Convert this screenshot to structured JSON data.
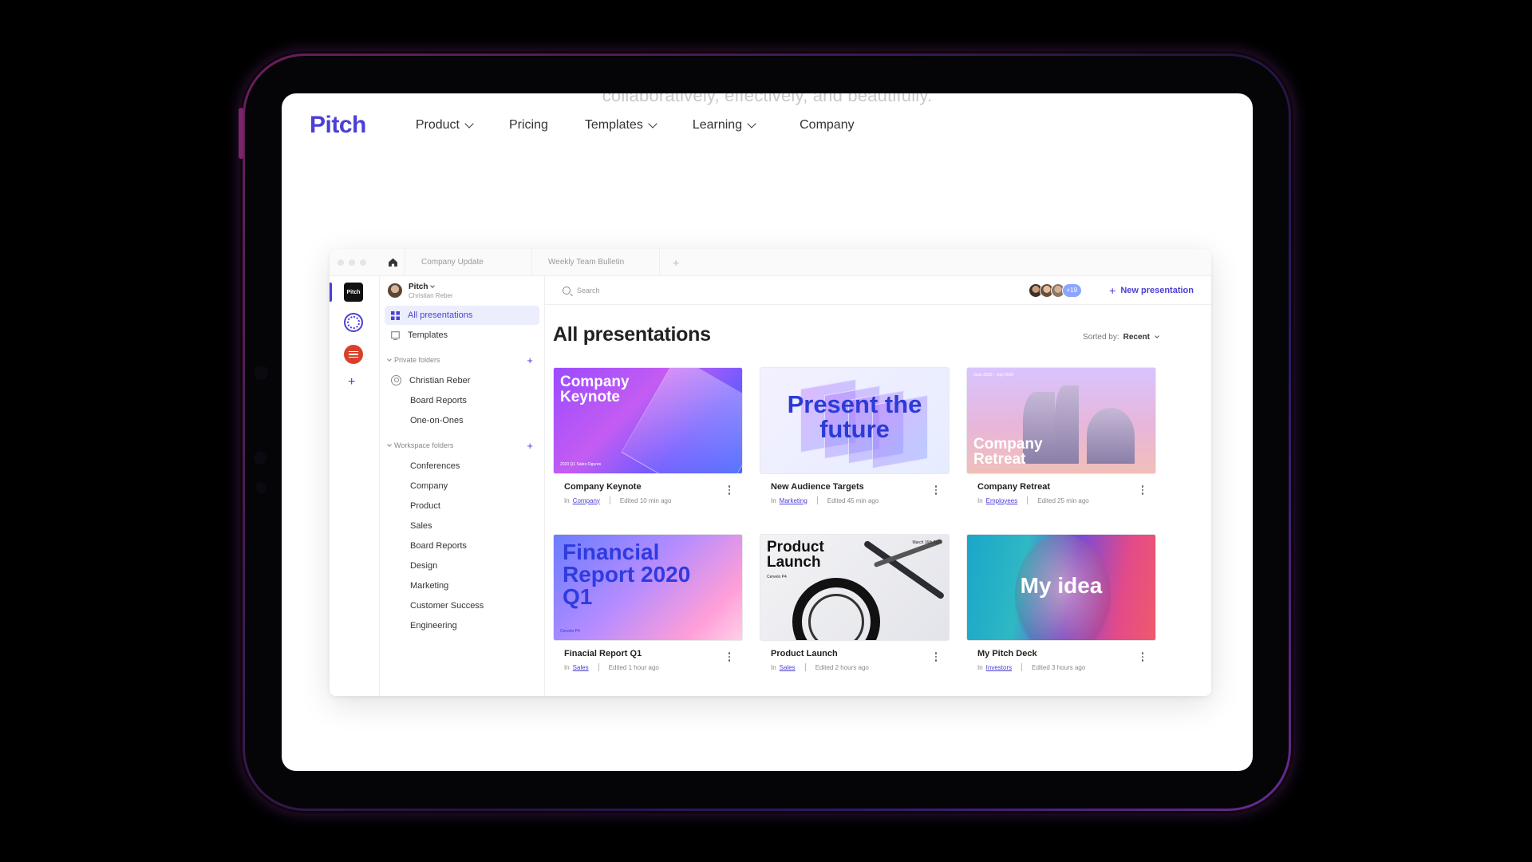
{
  "website": {
    "ghost_text": "collaboratively, effectively, and beautifully.",
    "logo": "Pitch",
    "nav": [
      {
        "label": "Product",
        "has_dropdown": true
      },
      {
        "label": "Pricing",
        "has_dropdown": false
      },
      {
        "label": "Templates",
        "has_dropdown": true
      },
      {
        "label": "Learning",
        "has_dropdown": true
      },
      {
        "label": "Company",
        "has_dropdown": false
      }
    ]
  },
  "app": {
    "tabs": [
      "Company Update",
      "Weekly Team Bulletin"
    ],
    "rail_logo": "Pitch",
    "user": {
      "workspace": "Pitch",
      "name": "Christian Reber"
    },
    "sidebar": {
      "all_presentations": "All presentations",
      "templates": "Templates",
      "private_folders_label": "Private folders",
      "private_folders": [
        "Christian Reber",
        "Board Reports",
        "One-on-Ones"
      ],
      "workspace_folders_label": "Workspace folders",
      "workspace_folders": [
        "Conferences",
        "Company",
        "Product",
        "Sales",
        "Board Reports",
        "Design",
        "Marketing",
        "Customer Success",
        "Engineering"
      ]
    },
    "search_placeholder": "Search",
    "collaborator_count": "+19",
    "new_presentation": "New presentation",
    "page_title": "All presentations",
    "sort_label": "Sorted by:",
    "sort_value": "Recent",
    "in_prefix": "In",
    "cards": [
      {
        "thumb_title": "Company Keynote",
        "thumb_caption": "2020 Q1 Sales Figures",
        "name": "Company Keynote",
        "folder": "Company",
        "edited": "Edited 10 min ago"
      },
      {
        "thumb_title": "Present the future",
        "thumb_caption": "",
        "name": "New Audience Targets",
        "folder": "Marketing",
        "edited": "Edited 45 min ago"
      },
      {
        "thumb_title": "Company Retreat",
        "thumb_caption": "June 2020 – July 2020",
        "name": "Company Retreat",
        "folder": "Employees",
        "edited": "Edited 25 min ago"
      },
      {
        "thumb_title": "Financial Report 2020 Q1",
        "thumb_caption": "Cervelo P4",
        "name": "Finacial Report Q1",
        "folder": "Sales",
        "edited": "Edited 1 hour ago"
      },
      {
        "thumb_title": "Product Launch",
        "thumb_caption": "Cervelo P4",
        "thumb_date": "March 16th 2020",
        "name": "Product Launch",
        "folder": "Sales",
        "edited": "Edited 2 hours ago"
      },
      {
        "thumb_title": "My idea",
        "thumb_caption": "",
        "name": "My Pitch Deck",
        "folder": "Investors",
        "edited": "Edited 3 hours ago"
      }
    ],
    "accent_color": "#4b3fd6"
  }
}
